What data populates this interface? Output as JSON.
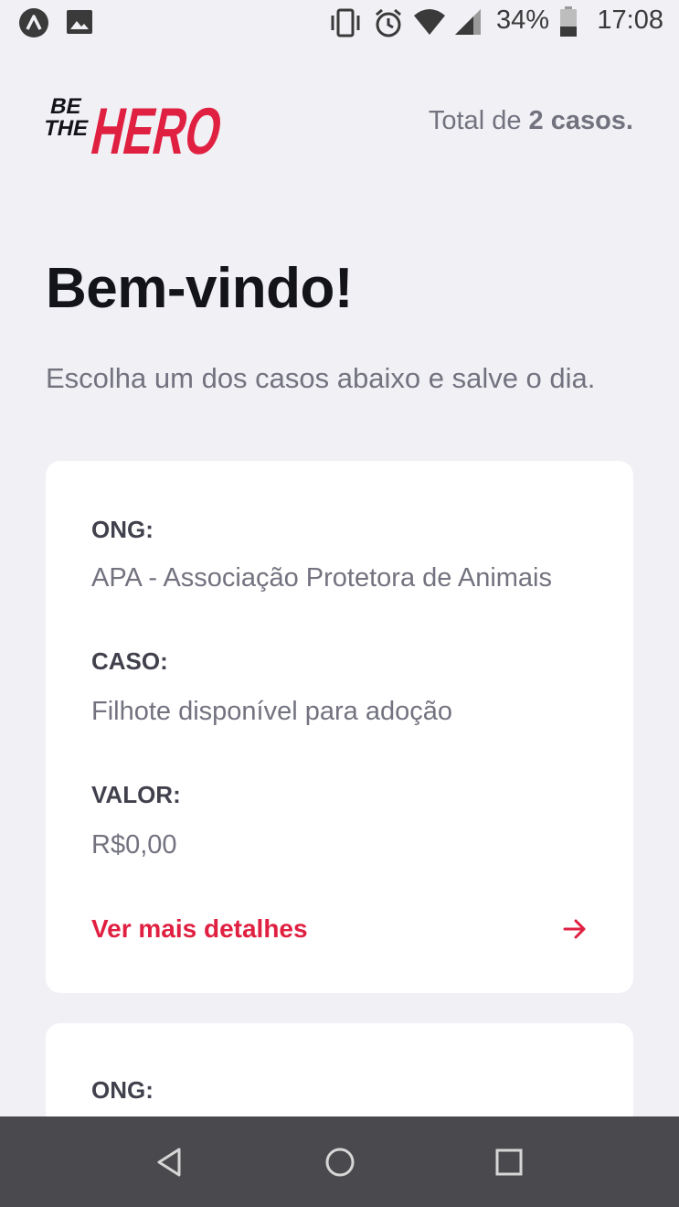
{
  "status_bar": {
    "battery_percent": "34%",
    "time": "17:08",
    "icons": [
      "app-notification-icon",
      "image-notification-icon",
      "vibrate-icon",
      "alarm-icon",
      "wifi-icon",
      "cell-signal-icon",
      "battery-icon"
    ]
  },
  "header": {
    "logo_text": "BE THE HERO",
    "total_prefix": "Total de ",
    "total_count": "2 casos.",
    "accent_color": "#e02041"
  },
  "main": {
    "title": "Bem-vindo!",
    "description": "Escolha um dos casos abaixo e salve o dia."
  },
  "incidents": [
    {
      "ong_label": "ONG:",
      "ong_value": "APA - Associação Protetora de Animais",
      "case_label": "CASO:",
      "case_value": "Filhote disponível para adoção",
      "value_label": "VALOR:",
      "value_value": "R$0,00",
      "details_label": "Ver mais detalhes"
    },
    {
      "ong_label": "ONG:"
    }
  ],
  "nav_bar": {
    "buttons": [
      "back-icon",
      "home-icon",
      "recents-icon"
    ]
  }
}
